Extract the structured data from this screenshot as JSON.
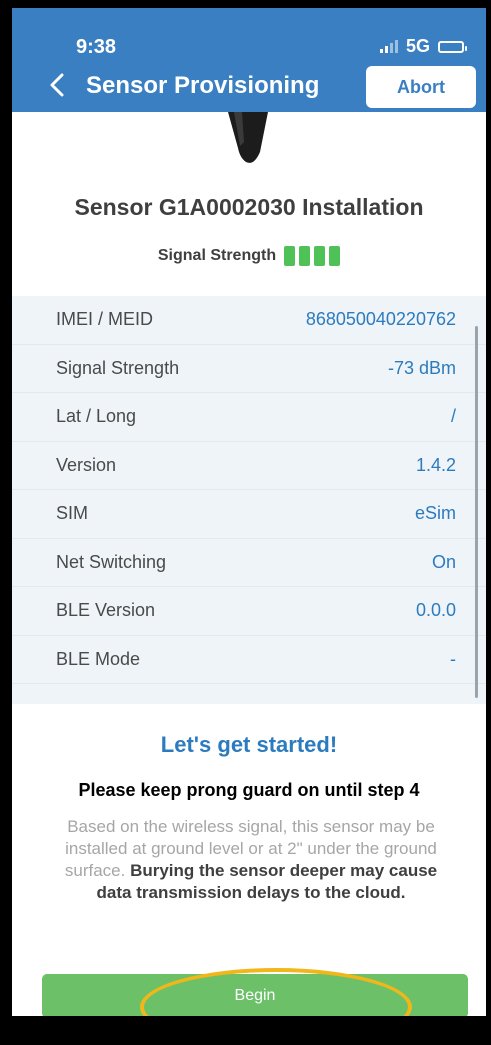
{
  "status": {
    "time": "9:38",
    "network": "5G"
  },
  "header": {
    "title": "Sensor Provisioning",
    "abort_label": "Abort"
  },
  "install_title": "Sensor G1A0002030 Installation",
  "signal_label": "Signal Strength",
  "info_rows": [
    {
      "label": "IMEI / MEID",
      "value": "868050040220762"
    },
    {
      "label": "Signal Strength",
      "value": "-73 dBm"
    },
    {
      "label": "Lat / Long",
      "value": "/"
    },
    {
      "label": "Version",
      "value": "1.4.2"
    },
    {
      "label": "SIM",
      "value": "eSim"
    },
    {
      "label": "Net Switching",
      "value": "On"
    },
    {
      "label": "BLE Version",
      "value": "0.0.0"
    },
    {
      "label": "BLE Mode",
      "value": "-"
    }
  ],
  "started_title": "Let's get started!",
  "keep_text": "Please keep prong guard on until step 4",
  "desc_plain": "Based on the wireless signal, this sensor may be installed at ground level or at 2\" under the ground surface. ",
  "desc_bold": "Burying the sensor deeper may cause data transmission delays to the cloud.",
  "begin_label": "Begin",
  "colors": {
    "header": "#3a7fc1",
    "accent": "#2d7bbf",
    "signal_green": "#4fc257",
    "button_green": "#6cc068",
    "highlight": "#f1b71a"
  }
}
